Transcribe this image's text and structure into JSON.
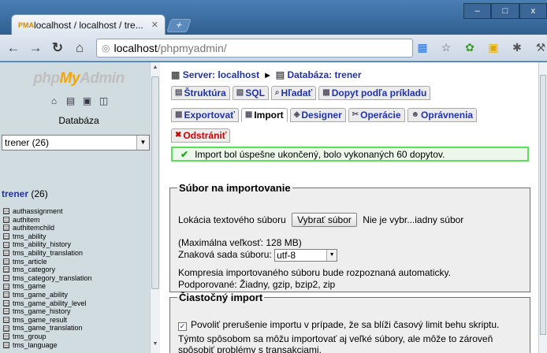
{
  "browser": {
    "tab_title": "localhost / localhost / tre...",
    "tab_favicon": "PMA",
    "new_tab": "+",
    "window_minimize": "–",
    "window_maximize": "□",
    "window_close": "x",
    "url_host": "localhost",
    "url_path": "/phpmyadmin/"
  },
  "sidebar": {
    "logo_prefix": "php",
    "logo_my": "My",
    "logo_suffix": "Admin",
    "db_label": "Databáza",
    "db_select": "trener (26)",
    "db_name": "trener",
    "db_count": "(26)",
    "tables": [
      "authassignment",
      "authitem",
      "authitemchild",
      "tms_ability",
      "tms_ability_history",
      "tms_ability_translation",
      "tms_article",
      "tms_category",
      "tms_category_translation",
      "tms_game",
      "tms_game_ability",
      "tms_game_ability_level",
      "tms_game_history",
      "tms_game_result",
      "tms_game_translation",
      "tms_group",
      "tms_language"
    ]
  },
  "main": {
    "breadcrumb_server": "Server: localhost",
    "breadcrumb_db": "Databáza: trener",
    "tabs_row1": [
      "Štruktúra",
      "SQL",
      "Hľadať",
      "Dopyt podľa príkladu"
    ],
    "tabs_row2": [
      "Exportovať",
      "Import",
      "Designer",
      "Operácie",
      "Oprávnenia"
    ],
    "tab_drop": "Odstrániť",
    "success_message": "Import bol úspešne ukončený, bolo vykonaných 60 dopytov.",
    "file_section": {
      "legend": "Súbor na importovanie",
      "location_label": "Lokácia textového súboru",
      "choose_button": "Vybrať súbor",
      "no_file": "Nie je vybr...iadny súbor",
      "max_size": "(Maximálna veľkosť: 128 MB)",
      "charset_label": "Znaková sada súboru:",
      "charset_value": "utf-8",
      "compression_note": "Kompresia importovaného súboru bude rozpoznaná automaticky.",
      "supported": "Podporované: Žiadny, gzip, bzip2, zip"
    },
    "partial_section": {
      "legend": "Čiastočný import",
      "allow_interrupt": "Povoliť prerušenie importu v prípade, že sa blíži časový limit behu skriptu.",
      "note_line1": "Týmto spôsobom sa môžu importovať aj veľké súbory, ale môže to zároveň",
      "note_line2": "spôsobiť problémy s transakciami."
    }
  },
  "colors": {
    "success_border": "#5ce05c",
    "link_blue": "#2233aa",
    "sidebar_bg": "#d0dce0"
  }
}
